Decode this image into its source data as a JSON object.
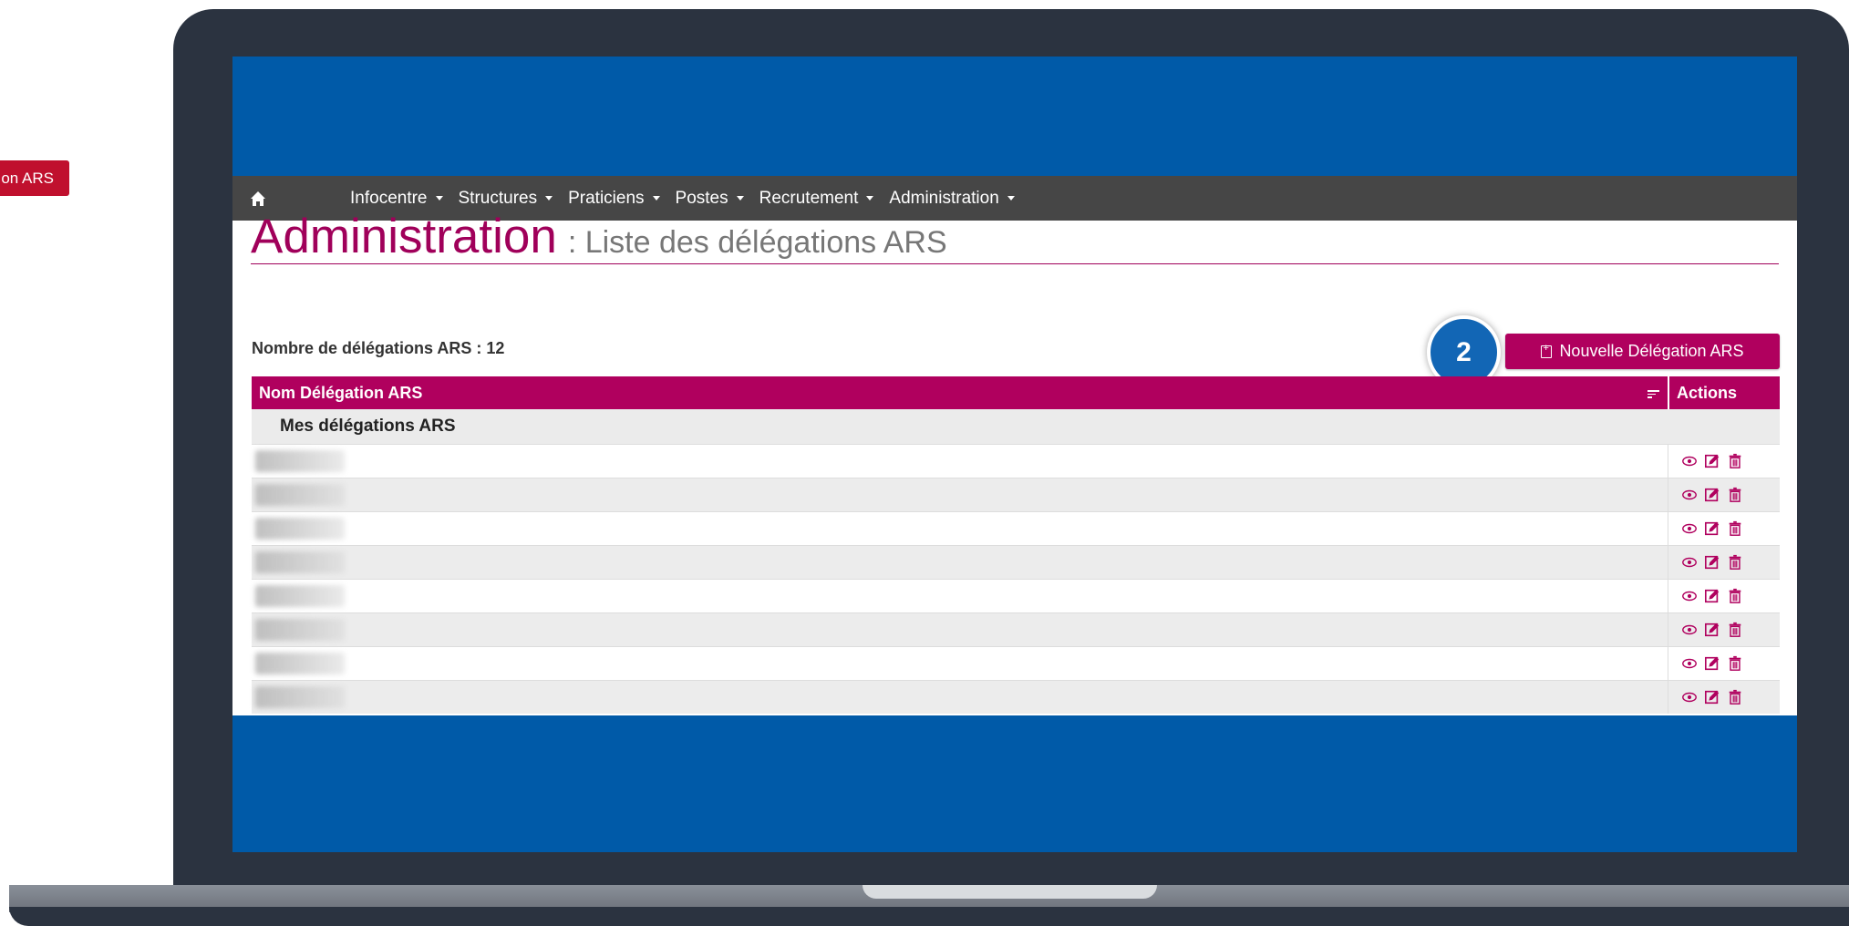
{
  "side_button": {
    "label": "on ARS"
  },
  "nav": {
    "items": [
      "Infocentre",
      "Structures",
      "Praticiens",
      "Postes",
      "Recrutement",
      "Administration"
    ]
  },
  "page": {
    "title": "Administration",
    "subtitle": ": Liste des délégations ARS",
    "count_label": "Nombre de délégations ARS : 12",
    "step_badge": "2",
    "new_button_label": "Nouvelle Délégation ARS"
  },
  "table": {
    "columns": {
      "name": "Nom Délégation ARS",
      "actions": "Actions"
    },
    "group_label": "Mes délégations ARS",
    "row_count_visible": 8
  },
  "colors": {
    "brand": "#b0005e",
    "nav": "#464646",
    "screen_blue": "#005aa8",
    "badge": "#1266b5"
  },
  "icons": [
    "home-icon",
    "sort-icon",
    "add-document-icon",
    "eye-icon",
    "edit-icon",
    "trash-icon"
  ]
}
